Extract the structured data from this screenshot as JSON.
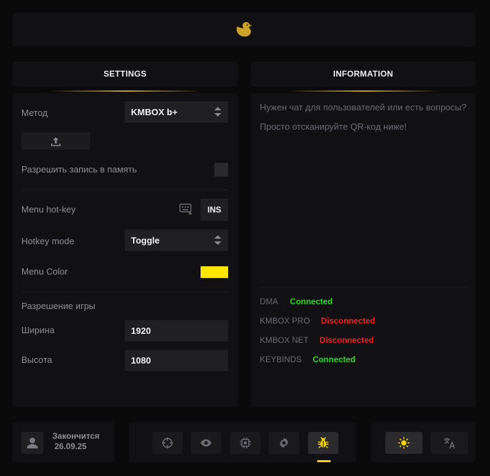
{
  "logo": {
    "icon": "duck-icon",
    "color": "#c9a227"
  },
  "settings": {
    "header": "SETTINGS",
    "method_label": "Метод",
    "method_value": "KMBOX b+",
    "write_memory_label": "Разрешить запись в память",
    "write_memory_checked": false,
    "menu_hotkey_label": "Menu hot-key",
    "menu_hotkey_value": "INS",
    "hotkey_mode_label": "Hotkey mode",
    "hotkey_mode_value": "Toggle",
    "menu_color_label": "Menu Color",
    "menu_color_value": "#ffe600",
    "resolution_label": "Разрешение игры",
    "width_label": "Ширина",
    "width_value": "1920",
    "height_label": "Высота",
    "height_value": "1080"
  },
  "information": {
    "header": "INFORMATION",
    "line1": "Нужен чат для пользователей или есть вопросы?",
    "line2": "Просто отсканируйте QR-код ниже!",
    "statuses": [
      {
        "name": "DMA",
        "value": "Connected",
        "color": "#22e31c"
      },
      {
        "name": "KMBOX PRO",
        "value": "Disconnected",
        "color": "#ff1f1f"
      },
      {
        "name": "KMBOX NET",
        "value": "Disconnected",
        "color": "#ff1f1f"
      },
      {
        "name": "KEYBINDS",
        "value": "Connected",
        "color": "#22e31c"
      }
    ]
  },
  "footer": {
    "expires_label": "Закончится",
    "expires_date": "26.09.25",
    "nav": [
      {
        "icon": "crosshair-icon",
        "active": false
      },
      {
        "icon": "eye-icon",
        "active": false
      },
      {
        "icon": "chip-icon",
        "active": false
      },
      {
        "icon": "gear-icon",
        "active": false
      },
      {
        "icon": "bug-icon",
        "active": true
      }
    ],
    "theme_icon": "sun-icon",
    "language_icon": "translate-icon",
    "accent": "#ffd600"
  }
}
